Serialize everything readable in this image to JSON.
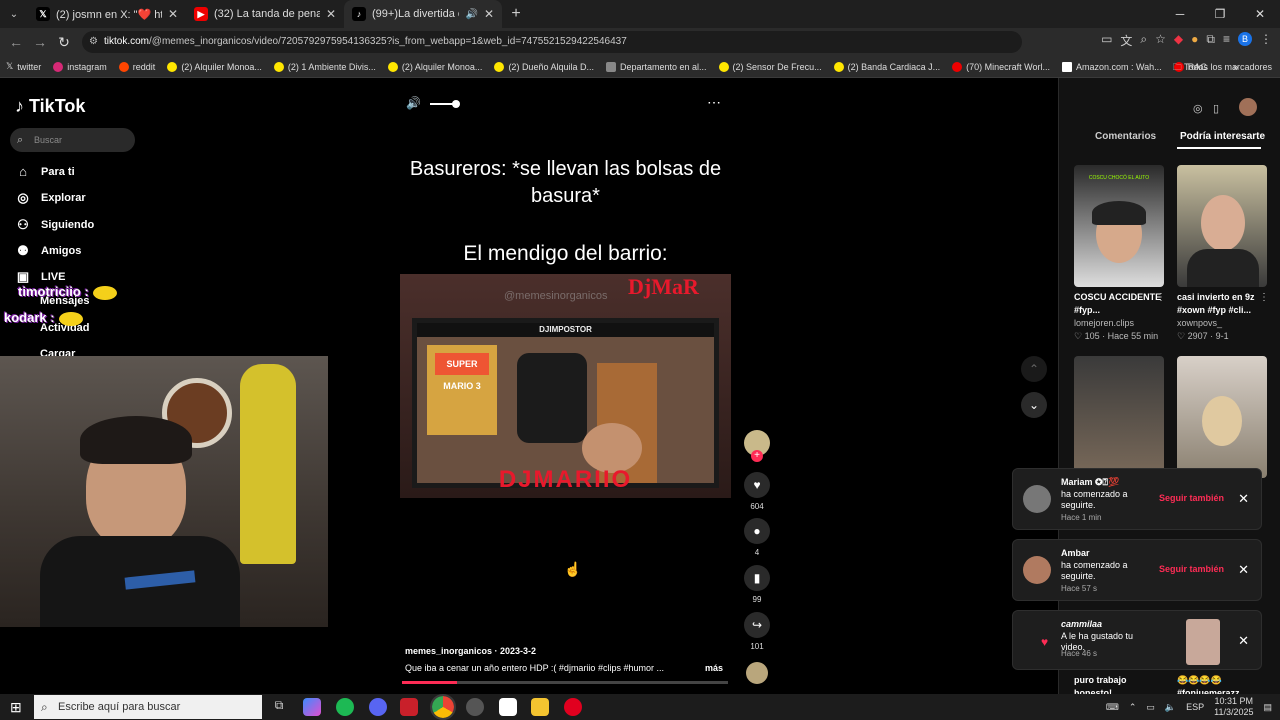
{
  "browser": {
    "tabs": [
      {
        "title": "(2) josmn en X: \"❤️ https://t.co",
        "icon": "x-icon",
        "active": false
      },
      {
        "title": "(32) La tanda de penaltis más i...",
        "icon": "youtube-icon",
        "active": false
      },
      {
        "title": "(99+)La divertida cena de D...",
        "icon": "tiktok-icon",
        "active": true
      }
    ],
    "new_tab_label": "+",
    "url_host": "tiktok.com",
    "url_path": "/@memes_inorganicos/video/7205792975954136325?is_from_webapp=1&web_id=7475521529422546437",
    "bookmarks": [
      "twitter",
      "instagram",
      "reddit",
      "(2) Alquiler Monoa...",
      "(2) 1 Ambiente Divis...",
      "(2) Alquiler Monoa...",
      "(2) Dueño Alquila D...",
      "Departamento en al...",
      "(2) Sensor De Frecu...",
      "(2) Banda Cardiaca J...",
      "(70) Minecraft Worl...",
      "Amazon.com : Wah...",
      "RAG"
    ],
    "bookmarks_more": "»",
    "all_bookmarks": "Todos los marcadores",
    "profile_letter": "B"
  },
  "tiktok": {
    "logo": "TikTok",
    "search_placeholder": "Buscar",
    "menu": [
      "Para ti",
      "Explorar",
      "Siguiendo",
      "Amigos",
      "LIVE",
      "Mensajes",
      "Actividad",
      "Cargar"
    ],
    "chat": [
      {
        "user": "timotriciio :"
      },
      {
        "user": "kodark :"
      }
    ],
    "video": {
      "caption_top": "Basureros: *se llevan las bolsas de basura*",
      "caption_mid": "El mendigo del barrio:",
      "watermark": "@memesinorganicos",
      "banner": "DJIMPOSTOR",
      "dj_text": "DjMaR",
      "bottom_text": "DJMARIIO",
      "author": "memes_inorganicos · 2023-3-2",
      "description": "Que iba a cenar un año entero HDP :( #djmariio  #clips  #humor  ...",
      "more": "más",
      "progress": 0.17
    },
    "actions": {
      "likes": "604",
      "comments": "4",
      "saves": "99",
      "shares": "101"
    },
    "right_tabs": [
      "Comentarios",
      "Podría interesarte"
    ],
    "suggestions": [
      {
        "title": "COSCU ACCIDENTE #fyp...",
        "user": "lomejoren.clips",
        "meta": "105 · Hace 55 min",
        "overlay": "COSCU CHOCÓ EL AUTO"
      },
      {
        "title": "casi invierto en 9z #xown #fyp #cli...",
        "user": "xownpovs_",
        "meta": "2907 · 9-1",
        "overlay": ""
      },
      {
        "title": "puro trabajo honesto!",
        "user": "",
        "meta": ""
      },
      {
        "title": "😂😂😂😂 #fonjuemerazz...",
        "user": "",
        "meta": ""
      }
    ],
    "notifications": [
      {
        "name": "Mariam ✪⍰💯",
        "text": "ha comenzado a seguirte.",
        "time": "Hace 1 min",
        "action": "Seguir también"
      },
      {
        "name": "Ambar",
        "text": "ha comenzado a seguirte.",
        "time": "Hace 57 s",
        "action": "Seguir también"
      },
      {
        "name": "cammilaa",
        "text": "A le ha gustado tu video.",
        "time": "Hace 46 s",
        "action": ""
      }
    ]
  },
  "taskbar": {
    "search_placeholder": "Escribe aquí para buscar",
    "lang": "ESP",
    "time": "10:31 PM",
    "date": "11/3/2025"
  }
}
